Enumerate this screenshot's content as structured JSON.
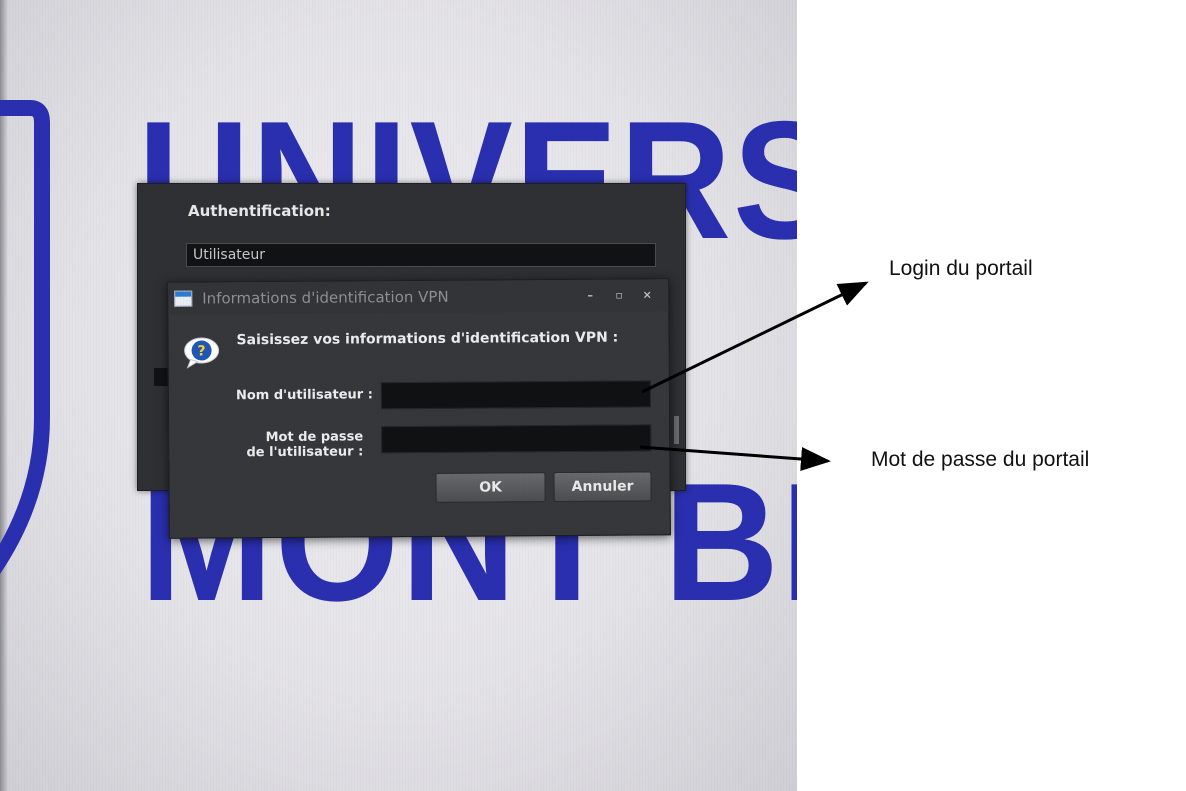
{
  "wallpaper": {
    "logo_line1": "UNIVERS",
    "logo_line2": "MONT BL",
    "logo_color": "#2a2fb0"
  },
  "auth_window": {
    "title": "Authentification:",
    "username_value": "Utilisateur"
  },
  "vpn_dialog": {
    "title": "Informations d'identification VPN",
    "window_buttons": {
      "minimize": "–",
      "maximize": "▫",
      "close": "×"
    },
    "prompt_icon": "question-icon",
    "prompt": "Saisissez vos informations d'identification VPN :",
    "username_label": "Nom d'utilisateur :",
    "password_label_line1": "Mot de passe",
    "password_label_line2": "de l'utilisateur :",
    "username_value": "",
    "password_value": "",
    "ok_label": "OK",
    "cancel_label": "Annuler"
  },
  "annotations": {
    "login_note": "Login du portail",
    "password_note": "Mot de passe du portail",
    "arrow_color": "#000000"
  }
}
